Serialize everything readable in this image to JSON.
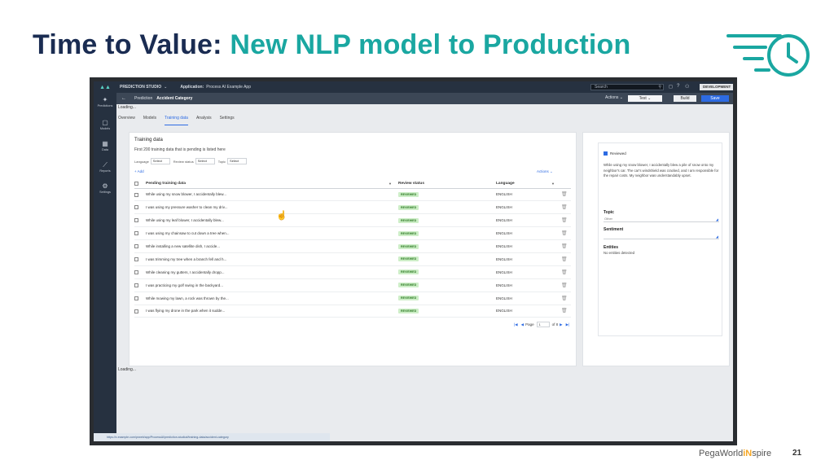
{
  "slide": {
    "title_part1": "Time to Value:",
    "title_part2": "New NLP model to Production",
    "footer_brand_a": "PegaWorld",
    "footer_brand_b": "iN",
    "footer_brand_c": "spire",
    "page_number": "21",
    "colors": {
      "navy": "#1a2c52",
      "teal": "#1aa7a1"
    },
    "icon": "speed-clock-icon"
  },
  "app": {
    "topbar": {
      "studio": "PREDICTION STUDIO",
      "app_label": "Application:",
      "app_name": "Process AI Example App",
      "search_placeholder": "Search",
      "env_badge": "DEVELOPMENT"
    },
    "subbar": {
      "crumb_parent": "Prediction",
      "crumb_current": "Accident Category",
      "actions": "Actions",
      "test": "Test",
      "build": "Build",
      "save": "Save"
    },
    "nav": [
      {
        "label": "Predictions",
        "icon": "sparkle-icon"
      },
      {
        "label": "Models",
        "icon": "box-icon"
      },
      {
        "label": "Data",
        "icon": "grid-icon"
      },
      {
        "label": "Reports",
        "icon": "chart-icon"
      },
      {
        "label": "Settings",
        "icon": "gear-icon"
      }
    ],
    "loading_text": "Loading...",
    "tabs": [
      "Overview",
      "Models",
      "Training data",
      "Analysis",
      "Settings"
    ],
    "active_tab": "Training data",
    "training": {
      "title": "Training data",
      "description": "First 200 training data that is pending is listed here",
      "filter_language_label": "Language",
      "filter_language": "Select",
      "filter_review_label": "Review status",
      "filter_review": "Select",
      "filter_topic_label": "Topic",
      "filter_topic": "Select",
      "add_label": "+ Add",
      "actions_label": "Actions ⌄",
      "columns": [
        "Pending training data",
        "Review status",
        "Language"
      ],
      "rows": [
        {
          "text": "While using my snow blower, I accidentally blew...",
          "status": "REVIEWED",
          "language": "ENGLISH"
        },
        {
          "text": "I was using my pressure washer to clean my driv...",
          "status": "REVIEWED",
          "language": "ENGLISH"
        },
        {
          "text": "While using my leaf blower, I accidentally blew...",
          "status": "REVIEWED",
          "language": "ENGLISH"
        },
        {
          "text": "I was using my chainsaw to cut down a tree when...",
          "status": "REVIEWED",
          "language": "ENGLISH"
        },
        {
          "text": "While installing a new satellite dish, I accide...",
          "status": "REVIEWED",
          "language": "ENGLISH"
        },
        {
          "text": "I was trimming my tree when a branch fell and h...",
          "status": "REVIEWED",
          "language": "ENGLISH"
        },
        {
          "text": "While cleaning my gutters, I accidentally dropp...",
          "status": "REVIEWED",
          "language": "ENGLISH"
        },
        {
          "text": "I was practicing my golf swing in the backyard...",
          "status": "REVIEWED",
          "language": "ENGLISH"
        },
        {
          "text": "While mowing my lawn, a rock was thrown by the...",
          "status": "REVIEWED",
          "language": "ENGLISH"
        },
        {
          "text": "I was flying my drone in the park when it sudde...",
          "status": "REVIEWED",
          "language": "ENGLISH"
        }
      ],
      "pager_page_label": "Page",
      "pager_page": "1",
      "pager_of": "of 8"
    },
    "detail": {
      "reviewed_label": "Reviewed",
      "text": "While using my snow blower, I accidentally blew a pile of snow onto my neighbor's car. The car's windshield was cracked, and I am responsible for the repair costs. My neighbor was understandably upset.",
      "topic_label": "Topic",
      "topic_value": "Other",
      "sentiment_label": "Sentiment",
      "sentiment_value": "",
      "entities_label": "Entities",
      "entities_value": "No entities detected"
    },
    "statusbar": "https://x.example.com/prweb/app/ProcessAI/prediction-studio#/training-data/accident-category"
  }
}
